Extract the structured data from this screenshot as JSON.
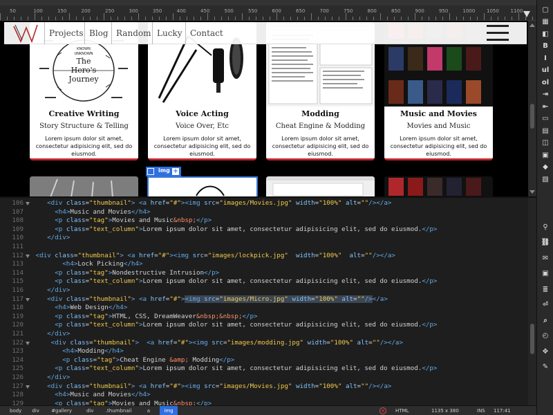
{
  "ruler": {
    "numbers": [
      "50",
      "100",
      "150",
      "200",
      "250",
      "300",
      "350",
      "400",
      "450",
      "500",
      "550",
      "600",
      "650",
      "700",
      "750",
      "800",
      "850",
      "900",
      "950",
      "1000",
      "1050",
      "1100"
    ]
  },
  "nav": {
    "links": [
      "Projects",
      "Blog",
      "Random",
      "Lucky",
      "Contact"
    ]
  },
  "cards": [
    {
      "title": "Creative Writing",
      "tag": "Story Structure & Telling",
      "text": "Lorem ipsum dolor sit amet, consectetur adipisicing elit, sed do eiusmod.",
      "journey": {
        "top": "KNOWN",
        "mid": "UNKNOWN",
        "title1": "The",
        "title2": "Hero's",
        "title3": "Journey"
      }
    },
    {
      "title": "Voice Acting",
      "tag": "Voice Over, Etc",
      "text": "Lorem ipsum dolor sit amet, consectetur adipisicing elit, sed do eiusmod."
    },
    {
      "title": "Modding",
      "tag": "Cheat Engine & Modding",
      "text": "Lorem ipsum dolor sit amet, consectetur adipisicing elit, sed do eiusmod."
    },
    {
      "title": "Music and Movies",
      "tag": "Movies and Music",
      "text": "Lorem ipsum dolor sit amet, consectetur adipisicing elit, sed do eiusmod."
    }
  ],
  "selection": {
    "tag": "img",
    "plus": "+"
  },
  "code": {
    "lines": [
      {
        "n": "106",
        "fold": true,
        "ind": "    ",
        "html": "<div class=\"thumbnail\"> <a href=\"#\"><img src=\"images/Movies.jpg\" width=\"100%\" alt=\"\"/></a>"
      },
      {
        "n": "107",
        "ind": "      ",
        "html": "<h4>Music and Movies</h4>"
      },
      {
        "n": "108",
        "ind": "      ",
        "html": "<p class=\"tag\">Movies and Music&nbsp;</p>"
      },
      {
        "n": "109",
        "ind": "      ",
        "html": "<p class=\"text_column\">Lorem ipsum dolor sit amet, consectetur adipisicing elit, sed do eiusmod.</p>"
      },
      {
        "n": "110",
        "ind": "    ",
        "html": "</div>"
      },
      {
        "n": "111",
        "ind": "",
        "html": ""
      },
      {
        "n": "112",
        "fold": true,
        "ind": " ",
        "html": "<div class=\"thumbnail\"> <a href=\"#\"><img src=\"images/lockpick.jpg\"  width=\"100%\"  alt=\"\"/></a>"
      },
      {
        "n": "113",
        "ind": "        ",
        "html": "<h4>Lock Picking</h4>"
      },
      {
        "n": "114",
        "ind": "      ",
        "html": "<p class=\"tag\">Nondestructive Intrusion</p>"
      },
      {
        "n": "115",
        "ind": "      ",
        "html": "<p class=\"text_column\">Lorem ipsum dolor sit amet, consectetur adipisicing elit, sed do eiusmod.</p>"
      },
      {
        "n": "116",
        "ind": "    ",
        "html": "</div>"
      },
      {
        "n": "117",
        "fold": true,
        "ind": "    ",
        "html": "<div class=\"thumbnail\"> <a href=\"#\"><img src=\"images/Micro.jpg\" width=\"100%\" alt=\"\"/></a>"
      },
      {
        "n": "118",
        "ind": "      ",
        "html": "<h4>Web Design</h4>"
      },
      {
        "n": "119",
        "ind": "      ",
        "html": "<p class=\"tag\">HTML, CSS, DreamWeaver&nbsp;&nbsp;</p>"
      },
      {
        "n": "120",
        "ind": "      ",
        "html": "<p class=\"text_column\">Lorem ipsum dolor sit amet, consectetur adipisicing elit, sed do eiusmod.</p>"
      },
      {
        "n": "121",
        "ind": "    ",
        "html": "</div>"
      },
      {
        "n": "122",
        "fold": true,
        "ind": "     ",
        "html": "<div class=\"thumbnail\">  <a href=\"#\"><img src=\"images/modding.jpg\" width=\"100%\" alt=\"\"/></a>"
      },
      {
        "n": "123",
        "ind": "        ",
        "html": "<h4>Modding</h4>"
      },
      {
        "n": "124",
        "ind": "        ",
        "html": "<p class=\"tag\">Cheat Engine &amp; Modding</p>"
      },
      {
        "n": "125",
        "ind": "      ",
        "html": "<p class=\"text_column\">Lorem ipsum dolor sit amet, consectetur adipisicing elit, sed do eiusmod.</p>"
      },
      {
        "n": "126",
        "ind": "    ",
        "html": "</div>"
      },
      {
        "n": "127",
        "fold": true,
        "ind": "    ",
        "html": "<div class=\"thumbnail\"> <a href=\"#\"><img src=\"images/Movies.jpg\" width=\"100%\" alt=\"\"/></a>"
      },
      {
        "n": "128",
        "ind": "      ",
        "html": "<h4>Music and Movies</h4>"
      },
      {
        "n": "129",
        "ind": "      ",
        "html": "<p class=\"tag\">Movies and Music&nbsp;</p>"
      }
    ]
  },
  "status": {
    "crumbs": [
      "body",
      "div",
      "#gallery",
      "div",
      ".thumbnail",
      "a",
      "img"
    ],
    "language": "HTML",
    "size": "1135 x 380",
    "mode": "INS",
    "position": "117:41"
  },
  "toolbar": {
    "icons": [
      "file-icon",
      "insert-icon",
      "css-icon",
      "bold-b-icon",
      "italic-i-icon",
      "ul-list-icon",
      "ol-list-icon",
      "indent-icon",
      "outdent-icon",
      "image-icon",
      "table-icon",
      "media-icon",
      "form-icon",
      "snippet-icon",
      "asset-icon",
      "tag-icon",
      "link-icon",
      "comment-icon",
      "preview-icon",
      "format-icon",
      "wrap-icon",
      "search-icon",
      "history-icon",
      "move-icon",
      "wrench-icon"
    ]
  },
  "colors": {
    "accent": "#c0272d",
    "selection": "#2f6fde"
  }
}
